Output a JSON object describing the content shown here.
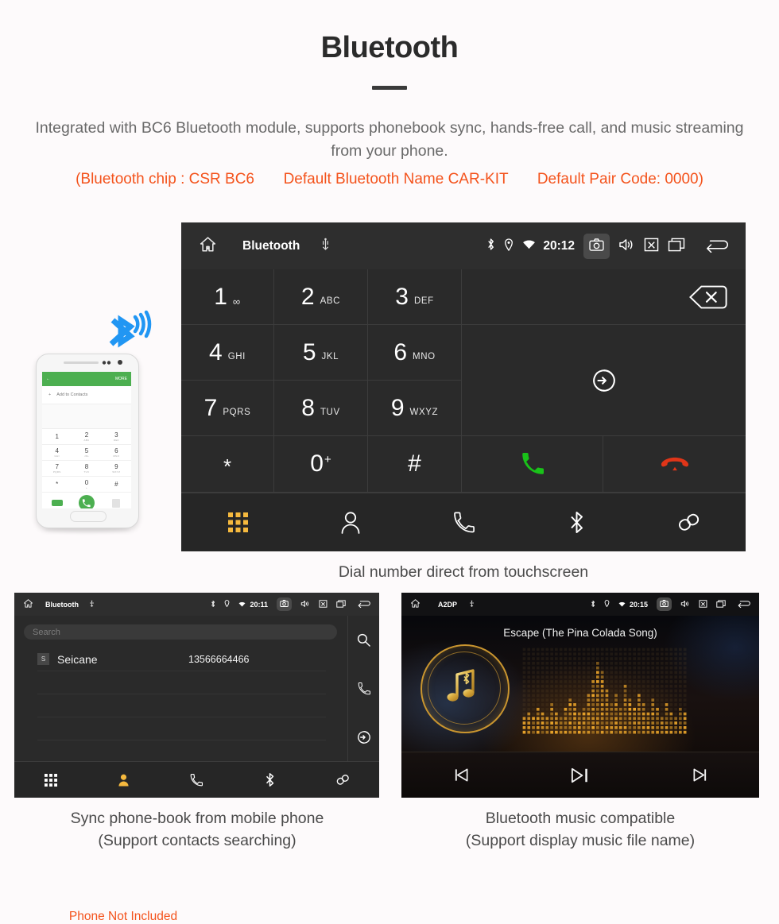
{
  "header": {
    "title": "Bluetooth",
    "intro": "Integrated with BC6 Bluetooth module, supports phonebook sync, hands-free call, and music streaming from your phone.",
    "spec_open": "(Bluetooth chip : CSR BC6",
    "spec_name": "Default Bluetooth Name CAR-KIT",
    "spec_code": "Default Pair Code: 0000)"
  },
  "dialer": {
    "statusbar": {
      "title": "Bluetooth",
      "clock": "20:12",
      "icons": [
        "home-icon",
        "usb-icon",
        "bluetooth-icon",
        "location-icon",
        "wifi-icon",
        "camera-icon",
        "volume-icon",
        "close-icon",
        "recents-icon",
        "back-icon"
      ]
    },
    "keys": [
      {
        "num": "1",
        "sub": "∞"
      },
      {
        "num": "2",
        "sub": "ABC"
      },
      {
        "num": "3",
        "sub": "DEF"
      },
      {
        "num": "4",
        "sub": "GHI"
      },
      {
        "num": "5",
        "sub": "JKL"
      },
      {
        "num": "6",
        "sub": "MNO"
      },
      {
        "num": "7",
        "sub": "PQRS"
      },
      {
        "num": "8",
        "sub": "TUV"
      },
      {
        "num": "9",
        "sub": "WXYZ"
      },
      {
        "num": "*",
        "sub": ""
      },
      {
        "num": "0",
        "sub": "+"
      },
      {
        "num": "#",
        "sub": ""
      }
    ],
    "actions": {
      "backspace": "backspace-icon",
      "sync": "sync-icon",
      "call": "call-icon",
      "hangup": "hangup-icon"
    },
    "navbar": [
      "dialpad-icon",
      "contacts-icon",
      "call-log-icon",
      "bluetooth-icon",
      "link-icon"
    ],
    "navbar_active_index": 0,
    "caption": "Dial number direct from touchscreen"
  },
  "phonebook": {
    "statusbar": {
      "title": "Bluetooth",
      "clock": "20:11"
    },
    "search_placeholder": "Search",
    "contacts": [
      {
        "initial": "S",
        "name": "Seicane",
        "number": "13566664466"
      }
    ],
    "side_actions": [
      "search-icon",
      "call-icon",
      "sync-icon"
    ],
    "navbar": [
      "dialpad-icon",
      "contacts-icon",
      "call-log-icon",
      "bluetooth-icon",
      "link-icon"
    ],
    "navbar_active_index": 1,
    "caption_line1": "Sync phone-book from mobile phone",
    "caption_line2": "(Support contacts searching)"
  },
  "music": {
    "statusbar": {
      "title": "A2DP",
      "clock": "20:15"
    },
    "song_title": "Escape (The Pina Colada Song)",
    "controls": [
      "previous-icon",
      "play-pause-icon",
      "next-icon"
    ],
    "caption_line1": "Bluetooth music compatible",
    "caption_line2": "(Support display music file name)"
  },
  "phone_mock": {
    "top_bar_label": "MORE",
    "add_contacts_label": "Add to Contacts",
    "keys": [
      {
        "num": "1",
        "sub": ""
      },
      {
        "num": "2",
        "sub": "ABC"
      },
      {
        "num": "3",
        "sub": "DEF"
      },
      {
        "num": "4",
        "sub": "GHI"
      },
      {
        "num": "5",
        "sub": "JKL"
      },
      {
        "num": "6",
        "sub": "MNO"
      },
      {
        "num": "7",
        "sub": "PQRS"
      },
      {
        "num": "8",
        "sub": "TUV"
      },
      {
        "num": "9",
        "sub": "WXYZ"
      },
      {
        "num": "*",
        "sub": ""
      },
      {
        "num": "0",
        "sub": "+"
      },
      {
        "num": "#",
        "sub": ""
      }
    ],
    "disclaimer": "Phone Not Included"
  },
  "colors": {
    "accent_orange": "#f4531c",
    "screen_dark": "#2a2a2a",
    "nav_active": "#f5b93e",
    "call_green": "#19c219",
    "hangup_red": "#e03518",
    "gold": "#c9952f"
  }
}
